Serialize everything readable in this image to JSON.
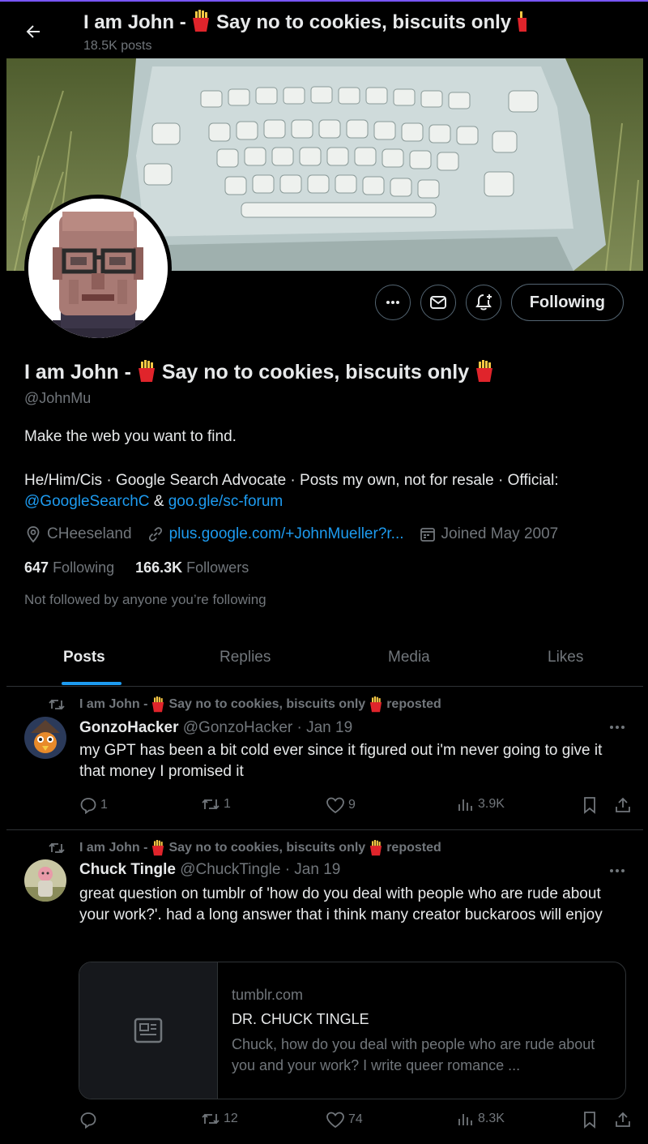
{
  "header": {
    "title_part1": "I am John - ",
    "title_part2": " Say no to cookies, biscuits only ",
    "posts_count": "18.5K posts"
  },
  "profile": {
    "name_part1": "I am John - ",
    "name_part2": " Say no to cookies, biscuits only ",
    "handle": "@JohnMu",
    "bio_line1": "Make the web you want to find.",
    "bio_line2": "He/Him/Cis · Google Search Advocate · Posts my own, not for resale · Official:",
    "bio_link1": "@GoogleSearchC",
    "bio_amp": " & ",
    "bio_link2": "goo.gle/sc-forum",
    "location": "CHeeseland",
    "website": "plus.google.com/+JohnMueller?r...",
    "joined": "Joined May 2007",
    "following_count": "647",
    "following_label": "Following",
    "followers_count": "166.3K",
    "followers_label": "Followers",
    "not_followed": "Not followed by anyone you’re following",
    "follow_button": "Following"
  },
  "tabs": [
    "Posts",
    "Replies",
    "Media",
    "Likes"
  ],
  "posts": [
    {
      "repost_by_part1": "I am John - ",
      "repost_by_part2": " Say no to cookies, biscuits only ",
      "repost_label": "reposted",
      "author": "GonzoHacker",
      "handle": "@GonzoHacker · Jan 19",
      "text": "my GPT has been a bit cold ever since it figured out i'm never going to give it that money I promised it",
      "replies": "1",
      "reposts": "1",
      "likes": "9",
      "views": "3.9K"
    },
    {
      "repost_by_part1": "I am John - ",
      "repost_by_part2": " Say no to cookies, biscuits only ",
      "repost_label": "reposted",
      "author": "Chuck Tingle",
      "handle": "@ChuckTingle · Jan 19",
      "text": "great question on tumblr of 'how do you deal with people who are rude about your work?'. had a long answer that i think many creator buckaroos will enjoy",
      "card_domain": "tumblr.com",
      "card_title": "DR. CHUCK TINGLE",
      "card_desc": "Chuck, how do you deal with people who are rude about you and your work? I write queer romance ...",
      "replies": "",
      "reposts": "12",
      "likes": "74",
      "views": "8.3K"
    }
  ],
  "colors": {
    "background": "#000000",
    "accent": "#1d9bf0",
    "muted": "#71767b",
    "divider": "#2f3336"
  }
}
